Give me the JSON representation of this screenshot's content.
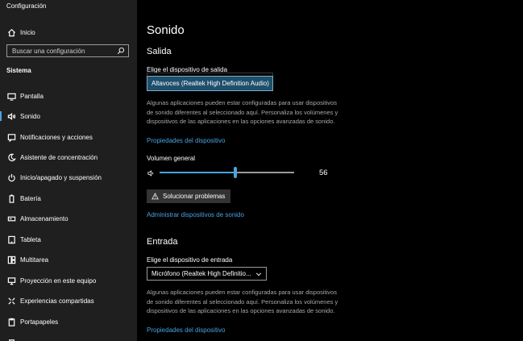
{
  "window": {
    "title": "Configuración"
  },
  "sidebar": {
    "home_label": "Inicio",
    "search_placeholder": "Buscar una configuración",
    "section_title": "Sistema",
    "items": [
      {
        "label": "Pantalla",
        "icon": "display-icon"
      },
      {
        "label": "Sonido",
        "icon": "speaker-icon",
        "selected": true
      },
      {
        "label": "Notificaciones y acciones",
        "icon": "notifications-icon"
      },
      {
        "label": "Asistente de concentración",
        "icon": "moon-icon"
      },
      {
        "label": "Inicio/apagado y suspensión",
        "icon": "power-icon"
      },
      {
        "label": "Batería",
        "icon": "battery-icon"
      },
      {
        "label": "Almacenamiento",
        "icon": "storage-icon"
      },
      {
        "label": "Tableta",
        "icon": "tablet-icon"
      },
      {
        "label": "Multitarea",
        "icon": "multitask-icon"
      },
      {
        "label": "Proyección en este equipo",
        "icon": "projection-icon"
      },
      {
        "label": "Experiencias compartidas",
        "icon": "shared-icon"
      },
      {
        "label": "Portapapeles",
        "icon": "clipboard-icon"
      }
    ]
  },
  "main": {
    "title": "Sonido",
    "output": {
      "heading": "Salida",
      "device_label": "Elige el dispositivo de salida",
      "device_selected": "Altavoces (Realtek High Definition Audio)",
      "description": "Algunas aplicaciones pueden estar configuradas para usar dispositivos de sonido diferentes al seleccionado aquí. Personaliza los volúmenes y dispositivos de las aplicaciones en las opciones avanzadas de sonido.",
      "properties_link": "Propiedades del dispositivo",
      "volume_label": "Volumen general",
      "volume_value": "56",
      "volume_level": 0.56,
      "troubleshoot_button": "Solucionar problemas",
      "manage_link": "Administrar dispositivos de sonido"
    },
    "input": {
      "heading": "Entrada",
      "device_label": "Elige el dispositivo de entrada",
      "device_selected": "Micrófono (Realtek High Definitio...",
      "description": "Algunas aplicaciones pueden estar configuradas para usar dispositivos de sonido diferentes al seleccionado aquí. Personaliza los volúmenes y dispositivos de las aplicaciones en las opciones avanzadas de sonido.",
      "properties_link": "Propiedades del dispositivo"
    }
  },
  "colors": {
    "accent": "#4aa3e0",
    "sidebar_bg": "#1f1f1f",
    "main_bg": "#000000",
    "dropdown_open_bg": "#1e4f6c"
  }
}
